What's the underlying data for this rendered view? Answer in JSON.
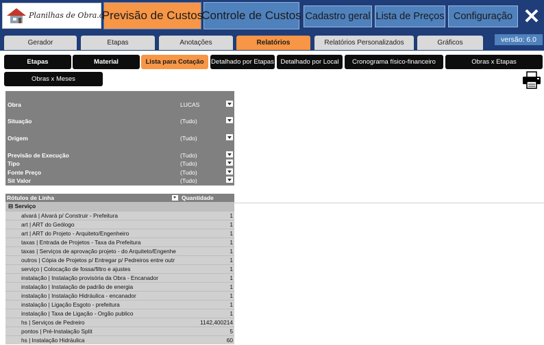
{
  "app": {
    "logo_text": "Planilhas de Obra.com",
    "primary_buttons": {
      "previsao": "Previsão de Custos",
      "controle": "Controle de Custos"
    },
    "nav": {
      "cadastro": "Cadastro geral",
      "lista": "Lista de Preços",
      "configuracao": "Configuração"
    },
    "close_label": "✕",
    "version": "versão: 6.0"
  },
  "tabs": [
    "Gerador",
    "Etapas",
    "Anotações",
    "Relatórios",
    "Relatórios Personalizados",
    "Gráficos"
  ],
  "active_tab": "Relatórios",
  "subtabs": [
    "Etapas",
    "Material",
    "Lista para Cotação",
    "Detalhado por Etapas",
    "Detalhado por Local",
    "Cronograma físico-financeiro",
    "Obras x Etapas",
    "Obras x Meses"
  ],
  "active_subtab": "Lista para Cotação",
  "filters": {
    "obra": {
      "label": "Obra",
      "value": "LUCAS"
    },
    "situacao": {
      "label": "Situação",
      "value": "(Tudo)"
    },
    "origem": {
      "label": "Origem",
      "value": "(Tudo)"
    },
    "previsao": {
      "label": "Previsão de Execução",
      "value": "(Tudo)"
    },
    "tipo": {
      "label": "Tipo",
      "value": "(Tudo)"
    },
    "fonte": {
      "label": "Fonte Preço",
      "value": "(Tudo)"
    },
    "sitvalor": {
      "label": "Sit Valor",
      "value": "(Tudo)"
    }
  },
  "table": {
    "headers": {
      "rows": "Rótulos de Linha",
      "qty": "Quantidade"
    },
    "group": {
      "toggle": "⊟",
      "label": "Serviço"
    },
    "rows": [
      {
        "label": "alvará |  Alvará p/ Construir - Prefeitura",
        "qty": "1"
      },
      {
        "label": "art |  ART do Geólogo",
        "qty": "1"
      },
      {
        "label": "art |  ART do Projeto - Arquiteto/Engenheiro",
        "qty": "1"
      },
      {
        "label": "taxas |  Entrada de Projetos - Taxa da Prefeitura",
        "qty": "1"
      },
      {
        "label": "taxas |  Serviços de aprovação projeto - do Arquiteto/Engenhe",
        "qty": "1"
      },
      {
        "label": "outros |  Cópia de Projetos p/ Entregar p/ Pedreiros entre outr",
        "qty": "1"
      },
      {
        "label": "serviço |  Colocação de fossa/filtro e ajustes",
        "qty": "1"
      },
      {
        "label": "instalação |  Instalação provisória da Obra - Encanador",
        "qty": "1"
      },
      {
        "label": "instalação |  Instalação de padrão de energia",
        "qty": "1"
      },
      {
        "label": "instalação |  Instalação Hidráulica - encanador",
        "qty": "1"
      },
      {
        "label": "instalação |  Ligação Esgoto - prefeitura",
        "qty": "1"
      },
      {
        "label": "instalação |  Taxa de Ligação - Orgão publico",
        "qty": "1"
      },
      {
        "label": "hs |  Serviços de Pedreiro",
        "qty": "1142,400214"
      },
      {
        "label": "pontos |  Pré-Instalação Split",
        "qty": "5"
      },
      {
        "label": "hs |  Instalação Hidráulica",
        "qty": "60"
      }
    ]
  },
  "colors": {
    "navy": "#1f3d78",
    "blue": "#4f81bd",
    "orange": "#f79646",
    "grey": "#808080"
  },
  "icons": {
    "printer": "printer-icon",
    "close": "close-icon",
    "logo": "house-logo-icon"
  }
}
